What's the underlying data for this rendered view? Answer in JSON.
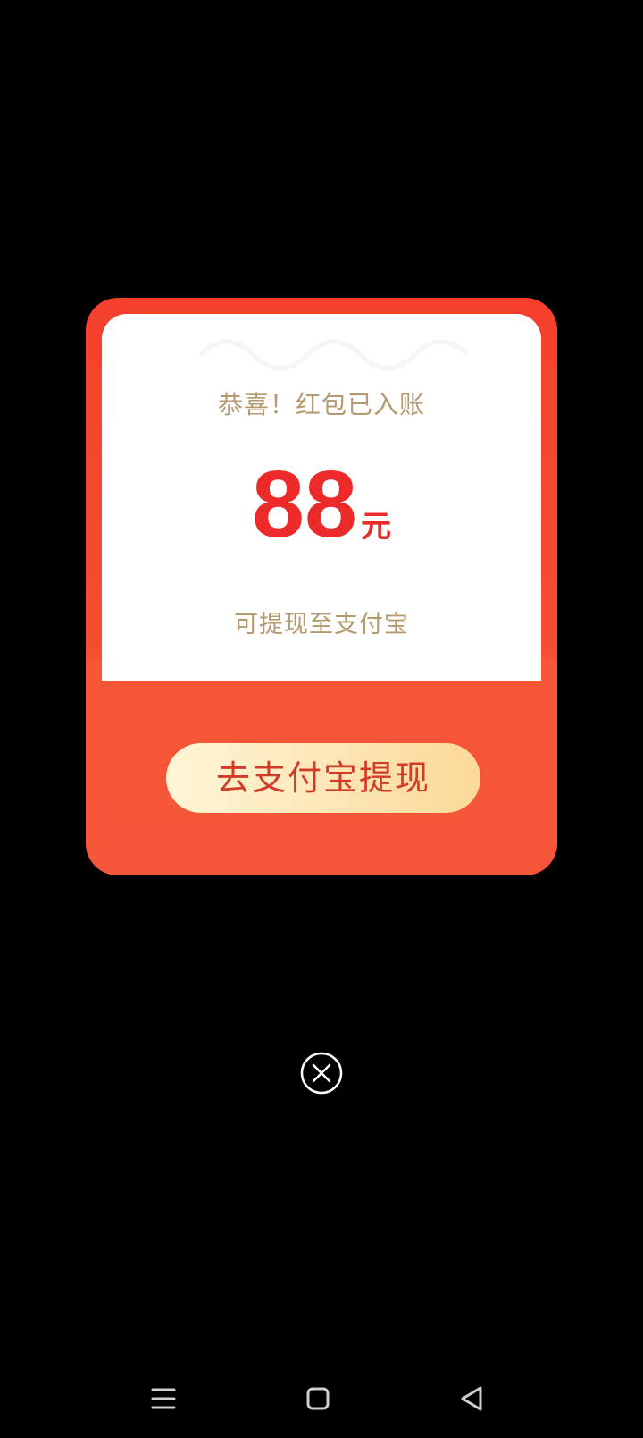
{
  "popup": {
    "congrats_text": "恭喜！红包已入账",
    "amount": "88",
    "unit": "元",
    "withdraw_hint": "可提现至支付宝",
    "cta_label": "去支付宝提现"
  },
  "colors": {
    "primary_red": "#f4402d",
    "amount_red": "#ec2a2a",
    "gold_text": "#b49a6e",
    "cta_gold": "#fde7b8"
  },
  "icons": {
    "close": "close-circle-icon",
    "nav_menu": "menu-icon",
    "nav_home": "home-square-icon",
    "nav_back": "back-triangle-icon"
  }
}
